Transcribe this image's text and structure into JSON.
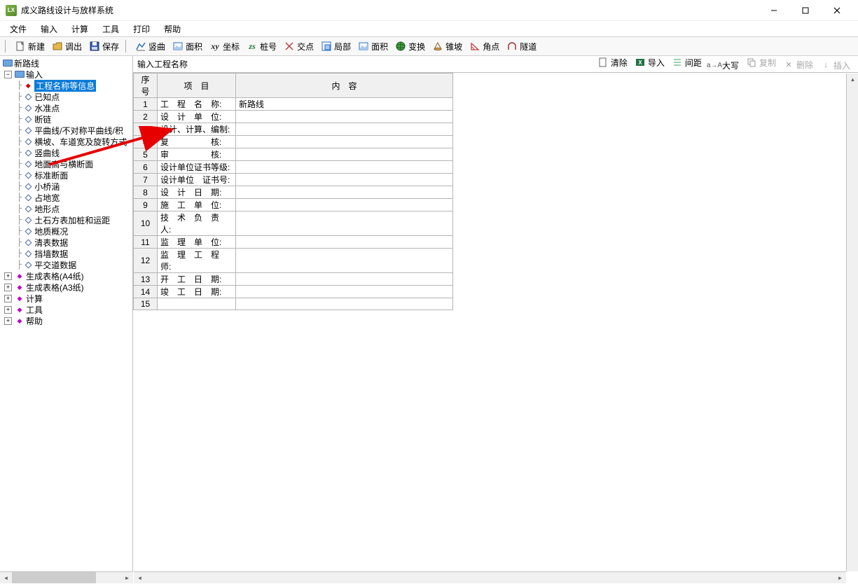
{
  "window": {
    "title": "成义路线设计与放样系统",
    "icon_text": "LX"
  },
  "menu": [
    "文件",
    "输入",
    "计算",
    "工具",
    "打印",
    "帮助"
  ],
  "toolbar": [
    {
      "id": "new",
      "label": "新建",
      "icon": "file"
    },
    {
      "id": "open",
      "label": "调出",
      "icon": "folder"
    },
    {
      "id": "save",
      "label": "保存",
      "icon": "disk"
    },
    {
      "id": "sep"
    },
    {
      "id": "vcurve",
      "label": "竖曲",
      "icon": "chart"
    },
    {
      "id": "area1",
      "label": "面积",
      "icon": "area"
    },
    {
      "id": "coord",
      "label": "坐标",
      "icon": "xy"
    },
    {
      "id": "stake",
      "label": "桩号",
      "icon": "zs"
    },
    {
      "id": "intersect",
      "label": "交点",
      "icon": "cross"
    },
    {
      "id": "local",
      "label": "局部",
      "icon": "local"
    },
    {
      "id": "area2",
      "label": "面积",
      "icon": "area"
    },
    {
      "id": "convert",
      "label": "变换",
      "icon": "globe"
    },
    {
      "id": "slope",
      "label": "锥坡",
      "icon": "cone"
    },
    {
      "id": "angle",
      "label": "角点",
      "icon": "angle"
    },
    {
      "id": "tunnel",
      "label": "隧道",
      "icon": "tunnel"
    }
  ],
  "tree": {
    "root": "新路线",
    "input": "输入",
    "input_children": [
      {
        "label": "工程名称等信息",
        "selected": true,
        "dot": "red"
      },
      {
        "label": "已知点"
      },
      {
        "label": "水准点"
      },
      {
        "label": "断链"
      },
      {
        "label": "平曲线/不对称平曲线/积"
      },
      {
        "label": "横坡、车道宽及旋转方式"
      },
      {
        "label": "竖曲线"
      },
      {
        "label": "地面高与横断面"
      },
      {
        "label": "标准断面"
      },
      {
        "label": "小桥涵"
      },
      {
        "label": "占地宽"
      },
      {
        "label": "地形点"
      },
      {
        "label": "土石方表加桩和运距"
      },
      {
        "label": "地质概况"
      },
      {
        "label": "清表数据"
      },
      {
        "label": "挡墙数据"
      },
      {
        "label": "平交道数据"
      }
    ],
    "bottom": [
      "生成表格(A4纸)",
      "生成表格(A3纸)",
      "计算",
      "工具",
      "帮助"
    ]
  },
  "panel": {
    "title": "输入工程名称",
    "buttons": [
      {
        "id": "clear",
        "label": "清除",
        "icon": "doc",
        "disabled": false
      },
      {
        "id": "import",
        "label": "导入",
        "icon": "xls",
        "disabled": false
      },
      {
        "id": "spacing",
        "label": "间距",
        "icon": "list",
        "disabled": false
      },
      {
        "id": "case",
        "label": "大写",
        "icon": "aA",
        "disabled": false
      },
      {
        "id": "copy",
        "label": "复制",
        "icon": "copy",
        "disabled": true
      },
      {
        "id": "delete",
        "label": "删除",
        "icon": "del",
        "disabled": true
      },
      {
        "id": "insert",
        "label": "插入",
        "icon": "ins",
        "disabled": true
      }
    ]
  },
  "grid": {
    "headers": [
      "序 号",
      "项　目",
      "内　容"
    ],
    "rows": [
      {
        "n": 1,
        "item": "工　程　名　称:",
        "content": "新路线"
      },
      {
        "n": 2,
        "item": "设　计　单　位:",
        "content": ""
      },
      {
        "n": 3,
        "item": "设计、计算、编制:",
        "content": ""
      },
      {
        "n": 4,
        "item": "复　　　　　核:",
        "content": ""
      },
      {
        "n": 5,
        "item": "审　　　　　核:",
        "content": ""
      },
      {
        "n": 6,
        "item": "设计单位证书等级:",
        "content": ""
      },
      {
        "n": 7,
        "item": "设计单位　证书号:",
        "content": ""
      },
      {
        "n": 8,
        "item": "设　计　日　期:",
        "content": ""
      },
      {
        "n": 9,
        "item": "施　工　单　位:",
        "content": ""
      },
      {
        "n": 10,
        "item": "技　术　负　责　人:",
        "content": ""
      },
      {
        "n": 11,
        "item": "监　理　单　位:",
        "content": ""
      },
      {
        "n": 12,
        "item": "监　理　工　程　师:",
        "content": ""
      },
      {
        "n": 13,
        "item": "开　工　日　期:",
        "content": ""
      },
      {
        "n": 14,
        "item": "竣　工　日　期:",
        "content": ""
      },
      {
        "n": 15,
        "item": "",
        "content": ""
      }
    ]
  }
}
